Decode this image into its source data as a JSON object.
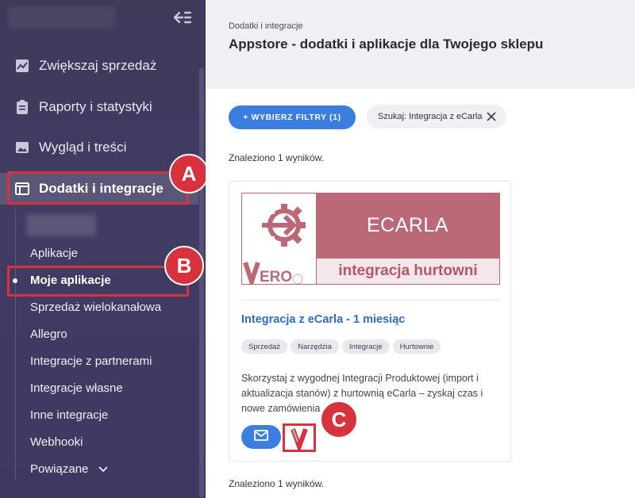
{
  "sidebar": {
    "menu": [
      {
        "label": "Zwiększaj sprzedaż",
        "icon": "chart-line-icon"
      },
      {
        "label": "Raporty i statystyki",
        "icon": "clipboard-icon"
      },
      {
        "label": "Wygląd i treści",
        "icon": "image-icon"
      },
      {
        "label": "Dodatki i integracje",
        "icon": "window-icon"
      }
    ],
    "submenu": [
      {
        "label": "Aplikacje"
      },
      {
        "label": "Moje aplikacje"
      },
      {
        "label": "Sprzedaż wielokanałowa"
      },
      {
        "label": "Allegro"
      },
      {
        "label": "Integracje z partnerami"
      },
      {
        "label": "Integracje własne"
      },
      {
        "label": "Inne integracje"
      },
      {
        "label": "Webhooki"
      },
      {
        "label": "Powiązane"
      }
    ]
  },
  "annotations": {
    "a": "A",
    "b": "B",
    "c": "C"
  },
  "header": {
    "breadcrumb": "Dodatki i integracje",
    "title": "Appstore - dodatki i aplikacje dla Twojego sklepu"
  },
  "filters": {
    "button_label": "+ WYBIERZ FILTRY (1)",
    "search_chip": "Szukaj: Integracja z eCarla"
  },
  "results": {
    "count_top": "Znaleziono 1 wyników.",
    "count_bottom": "Znaleziono 1 wyników."
  },
  "card": {
    "banner_top": "ECARLA",
    "banner_bottom": "integracja hurtowni",
    "banner_logo": "VERO",
    "title": "Integracja z eCarla - 1 miesiąc",
    "tags": [
      "Sprzedaż",
      "Narzędzia",
      "Integracje",
      "Hurtownie"
    ],
    "description": "Skorzystaj z wygodnej Integracji Produktowej (import i aktualizacja stanów) z hurtownią eCarla – zyskaj czas i nowe zamówienia"
  },
  "colors": {
    "sidebar_bg": "#3e3960",
    "accent_blue": "#3b7ee0",
    "highlight_red": "#d8323f",
    "banner_rose": "#bb6977"
  }
}
